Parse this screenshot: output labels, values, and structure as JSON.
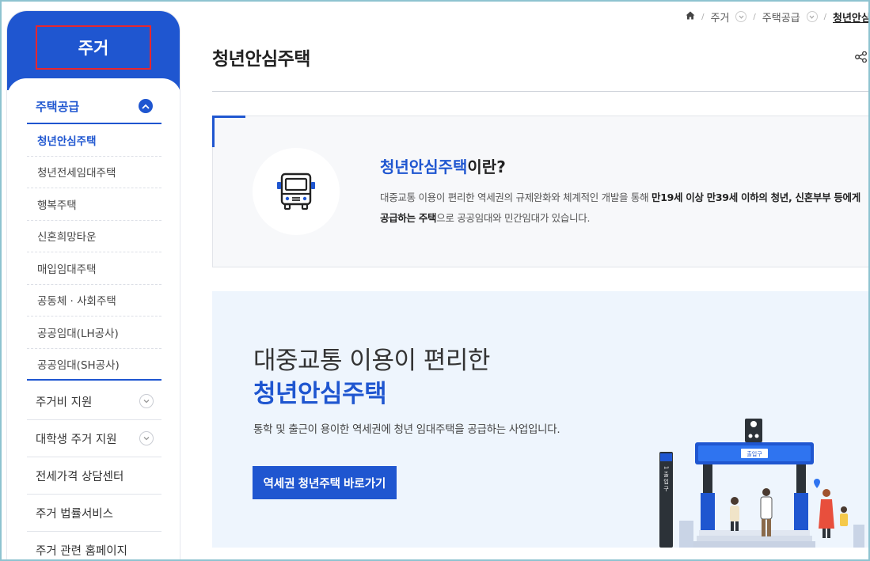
{
  "sidebar": {
    "title": "주거",
    "group": {
      "label": "주택공급"
    },
    "sub_items": [
      {
        "label": "청년안심주택",
        "active": true
      },
      {
        "label": "청년전세임대주택"
      },
      {
        "label": "행복주택"
      },
      {
        "label": "신혼희망타운"
      },
      {
        "label": "매입임대주택"
      },
      {
        "label": "공동체 · 사회주택"
      },
      {
        "label": "공공임대(LH공사)"
      },
      {
        "label": "공공임대(SH공사)"
      }
    ],
    "items": [
      {
        "label": "주거비 지원",
        "expandable": true
      },
      {
        "label": "대학생 주거 지원",
        "expandable": true
      },
      {
        "label": "전세가격 상담센터"
      },
      {
        "label": "주거 법률서비스"
      },
      {
        "label": "주거 관련 홈페이지"
      }
    ]
  },
  "breadcrumb": {
    "level1": "주거",
    "level2": "주택공급",
    "current": "청년안심주택"
  },
  "page": {
    "title": "청년안심주택"
  },
  "info": {
    "question_highlight": "청년안심주택",
    "question_rest": "이란?",
    "desc_part1": "대중교통 이용이 편리한 역세권의 규제완화와 체계적인 개발을 통해 ",
    "desc_bold": "만19세 이상 만39세 이하의 청년, 신혼부부 등에게 공급하는 주택",
    "desc_part2": "으로 공공임대와 민간임대가 있습니다."
  },
  "banner": {
    "line1": "대중교통 이용이 편리한",
    "line2": "청년안심주택",
    "sub": "통학 및 출근이 용이한 역세권에 청년 임대주택을 공급하는 사업입니다.",
    "cta": "역세권 청년주택 바로가기",
    "sign_text": "출입구",
    "pole_text": "1 출 입 구"
  },
  "colors": {
    "brand": "#1f56d0",
    "highlight_outline": "#e8262d",
    "banner_bg": "#eef5fd"
  }
}
